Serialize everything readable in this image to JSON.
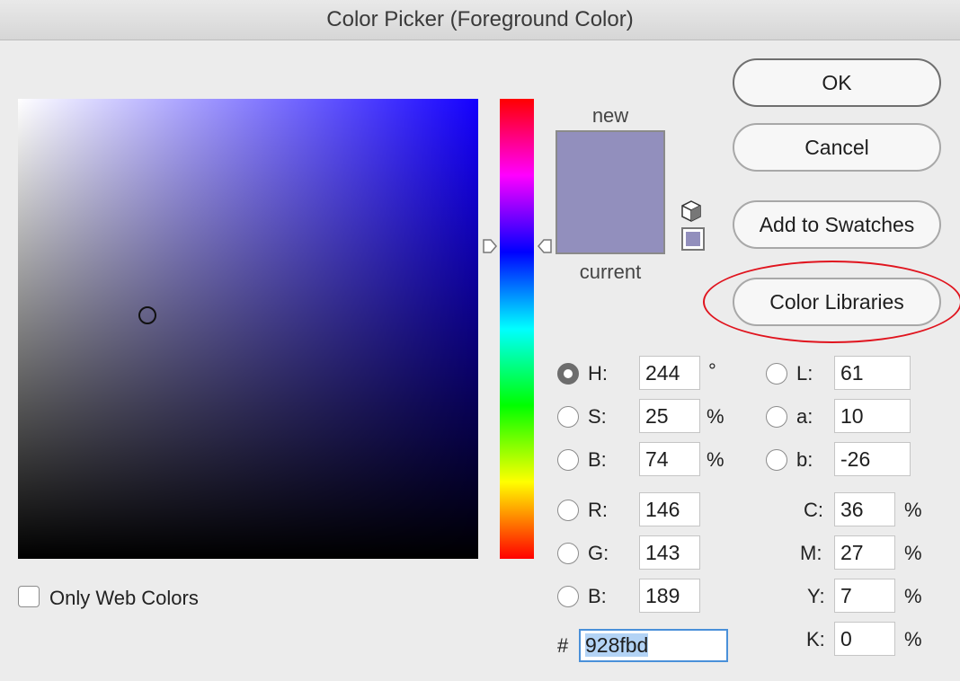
{
  "window": {
    "title": "Color Picker (Foreground Color)"
  },
  "colors": {
    "new": "#928fbd",
    "current": "#928fbd",
    "field_hue": "#1400ff",
    "highlight": "#e0141e"
  },
  "preview": {
    "new_label": "new",
    "current_label": "current"
  },
  "icons": {
    "gamut_warning": "cube-icon",
    "websafe": "websafe-swatch"
  },
  "buttons": {
    "ok": "OK",
    "cancel": "Cancel",
    "add_to_swatches": "Add to Swatches",
    "color_libraries": "Color Libraries"
  },
  "options": {
    "only_web_colors": "Only Web Colors"
  },
  "hsb": {
    "h": {
      "label": "H:",
      "value": "244",
      "unit": "°",
      "selected": true
    },
    "s": {
      "label": "S:",
      "value": "25",
      "unit": "%"
    },
    "b": {
      "label": "B:",
      "value": "74",
      "unit": "%"
    }
  },
  "lab": {
    "l": {
      "label": "L:",
      "value": "61"
    },
    "a": {
      "label": "a:",
      "value": "10"
    },
    "b": {
      "label": "b:",
      "value": "-26"
    }
  },
  "rgb": {
    "r": {
      "label": "R:",
      "value": "146"
    },
    "g": {
      "label": "G:",
      "value": "143"
    },
    "b": {
      "label": "B:",
      "value": "189"
    }
  },
  "cmyk": {
    "c": {
      "label": "C:",
      "value": "36",
      "unit": "%"
    },
    "m": {
      "label": "M:",
      "value": "27",
      "unit": "%"
    },
    "y": {
      "label": "Y:",
      "value": "7",
      "unit": "%"
    },
    "k": {
      "label": "K:",
      "value": "0",
      "unit": "%"
    }
  },
  "hex": {
    "label": "#",
    "value": "928fbd"
  }
}
